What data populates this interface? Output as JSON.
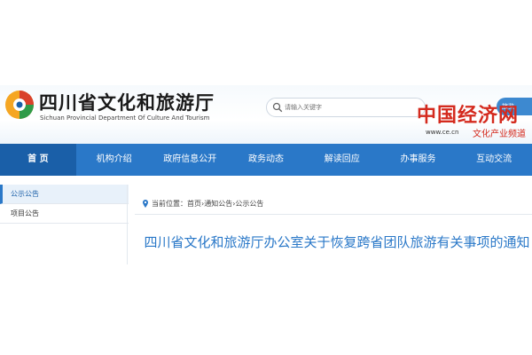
{
  "header": {
    "site_title": "四川省文化和旅游厅",
    "site_subtitle": "Sichuan Provincial Department Of Culture And Tourism",
    "search_placeholder": "请输入关键字",
    "side_button": "旅览"
  },
  "watermark": {
    "brand": "中国经济网",
    "url": "www.ce.cn",
    "slogan": "文化产业频道"
  },
  "nav": {
    "items": [
      {
        "label": "首 页"
      },
      {
        "label": "机构介绍"
      },
      {
        "label": "政府信息公开"
      },
      {
        "label": "政务动态"
      },
      {
        "label": "解读回应"
      },
      {
        "label": "办事服务"
      },
      {
        "label": "互动交流"
      }
    ]
  },
  "sidebar": {
    "items": [
      {
        "label": "公示公告"
      },
      {
        "label": "项目公告"
      }
    ]
  },
  "breadcrumb": {
    "prefix": "当前位置：",
    "path": "首页›通知公告›公示公告"
  },
  "article": {
    "title": "四川省文化和旅游厅办公室关于恢复跨省团队旅游有关事项的通知"
  },
  "colors": {
    "nav_blue": "#2a78c8",
    "nav_active": "#1a5fa8",
    "title_blue": "#2a78c8",
    "brand_red": "#d42a1e"
  }
}
